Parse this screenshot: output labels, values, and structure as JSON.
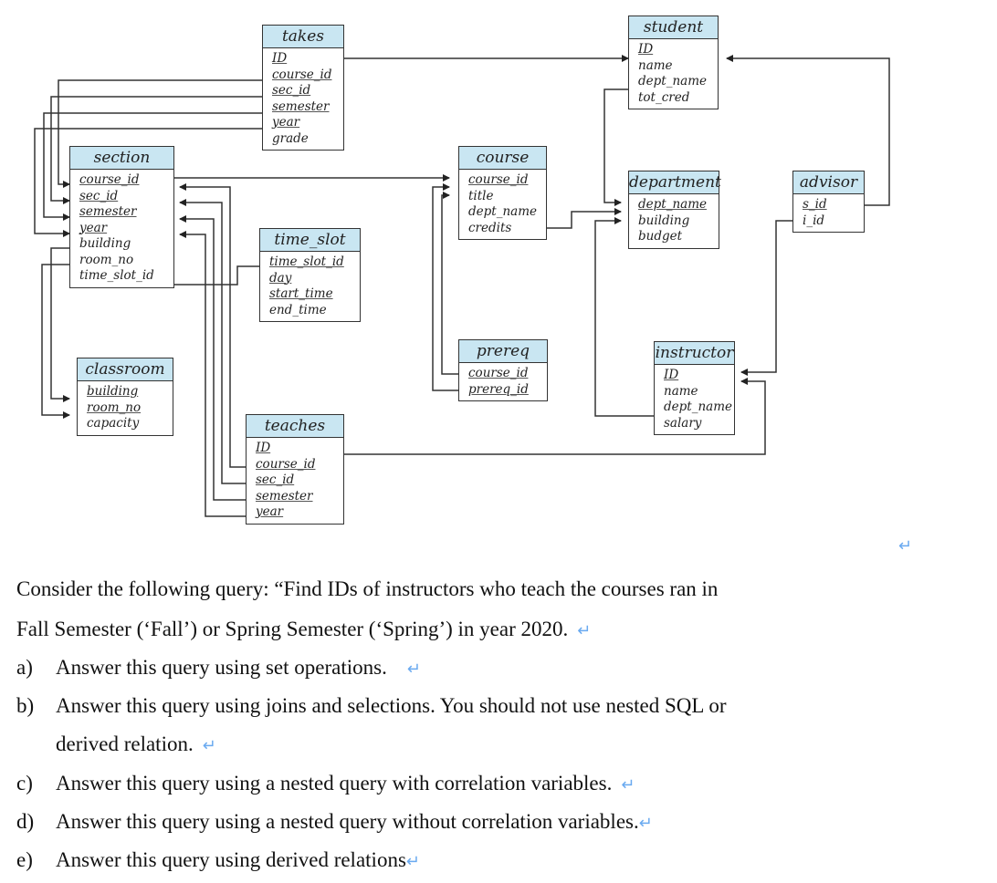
{
  "schema": {
    "takes": {
      "name": "takes",
      "attributes": [
        {
          "name": "ID",
          "pk": true
        },
        {
          "name": "course_id",
          "pk": true
        },
        {
          "name": "sec_id",
          "pk": true
        },
        {
          "name": "semester",
          "pk": true
        },
        {
          "name": "year",
          "pk": true
        },
        {
          "name": "grade",
          "pk": false
        }
      ]
    },
    "student": {
      "name": "student",
      "attributes": [
        {
          "name": "ID",
          "pk": true
        },
        {
          "name": "name",
          "pk": false
        },
        {
          "name": "dept_name",
          "pk": false
        },
        {
          "name": "tot_cred",
          "pk": false
        }
      ]
    },
    "section": {
      "name": "section",
      "attributes": [
        {
          "name": "course_id",
          "pk": true
        },
        {
          "name": "sec_id",
          "pk": true
        },
        {
          "name": "semester",
          "pk": true
        },
        {
          "name": "year",
          "pk": true
        },
        {
          "name": "building",
          "pk": false
        },
        {
          "name": "room_no",
          "pk": false
        },
        {
          "name": "time_slot_id",
          "pk": false
        }
      ]
    },
    "course": {
      "name": "course",
      "attributes": [
        {
          "name": "course_id",
          "pk": true
        },
        {
          "name": "title",
          "pk": false
        },
        {
          "name": "dept_name",
          "pk": false
        },
        {
          "name": "credits",
          "pk": false
        }
      ]
    },
    "department": {
      "name": "department",
      "attributes": [
        {
          "name": "dept_name",
          "pk": true
        },
        {
          "name": "building",
          "pk": false
        },
        {
          "name": "budget",
          "pk": false
        }
      ]
    },
    "advisor": {
      "name": "advisor",
      "attributes": [
        {
          "name": "s_id",
          "pk": true
        },
        {
          "name": "i_id",
          "pk": false
        }
      ]
    },
    "time_slot": {
      "name": "time_slot",
      "attributes": [
        {
          "name": "time_slot_id",
          "pk": true
        },
        {
          "name": "day",
          "pk": true
        },
        {
          "name": "start_time",
          "pk": true
        },
        {
          "name": "end_time",
          "pk": false
        }
      ]
    },
    "prereq": {
      "name": "prereq",
      "attributes": [
        {
          "name": "course_id",
          "pk": true
        },
        {
          "name": "prereq_id",
          "pk": true
        }
      ]
    },
    "instructor": {
      "name": "instructor",
      "attributes": [
        {
          "name": "ID",
          "pk": true
        },
        {
          "name": "name",
          "pk": false
        },
        {
          "name": "dept_name",
          "pk": false
        },
        {
          "name": "salary",
          "pk": false
        }
      ]
    },
    "classroom": {
      "name": "classroom",
      "attributes": [
        {
          "name": "building",
          "pk": true
        },
        {
          "name": "room_no",
          "pk": true
        },
        {
          "name": "capacity",
          "pk": false
        }
      ]
    },
    "teaches": {
      "name": "teaches",
      "attributes": [
        {
          "name": "ID",
          "pk": true
        },
        {
          "name": "course_id",
          "pk": true
        },
        {
          "name": "sec_id",
          "pk": true
        },
        {
          "name": "semester",
          "pk": true
        },
        {
          "name": "year",
          "pk": true
        }
      ]
    }
  },
  "return_mark": "↵",
  "question": {
    "intro_line1": "Consider the following query: “Find IDs of instructors who teach the courses ran in",
    "intro_line2": "Fall Semester (‘Fall’) or Spring Semester (‘Spring’) in year 2020.",
    "parts": [
      {
        "label": "a)",
        "text": "Answer this query using set operations."
      },
      {
        "label": "b)",
        "text": "Answer this query using joins and selections. You should not use nested SQL or",
        "text_cont": "derived relation."
      },
      {
        "label": "c)",
        "text": "Answer this query using a nested query with correlation variables."
      },
      {
        "label": "d)",
        "text": "Answer this query using a nested query without correlation variables."
      },
      {
        "label": "e)",
        "text": "Answer this query using derived relations"
      }
    ]
  },
  "colors": {
    "header_fill": "#c9e6f2",
    "line": "#333333",
    "return_mark": "#6aaaf0"
  }
}
